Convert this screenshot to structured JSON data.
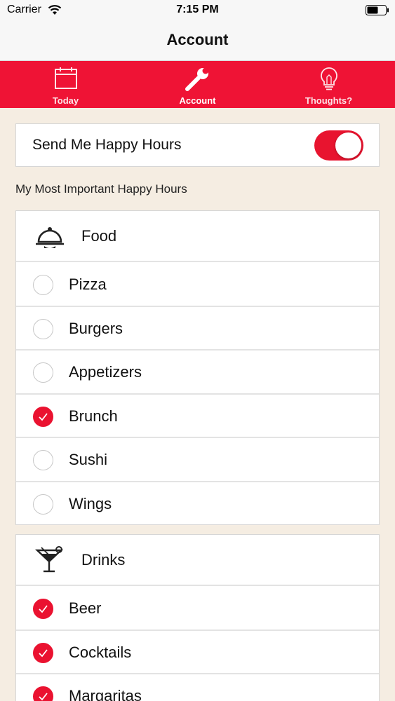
{
  "status_bar": {
    "carrier": "Carrier",
    "time": "7:15 PM"
  },
  "nav": {
    "title": "Account"
  },
  "tabs": [
    {
      "label": "Today",
      "icon": "calendar-icon"
    },
    {
      "label": "Account",
      "icon": "wrench-icon"
    },
    {
      "label": "Thoughts?",
      "icon": "lightbulb-icon"
    }
  ],
  "notifications": {
    "label": "Send Me Happy Hours",
    "enabled": true
  },
  "section_heading": "My Most Important Happy Hours",
  "categories": [
    {
      "name": "Food",
      "icon": "cloche-icon",
      "items": [
        {
          "label": "Pizza",
          "checked": false
        },
        {
          "label": "Burgers",
          "checked": false
        },
        {
          "label": "Appetizers",
          "checked": false
        },
        {
          "label": "Brunch",
          "checked": true
        },
        {
          "label": "Sushi",
          "checked": false
        },
        {
          "label": "Wings",
          "checked": false
        }
      ]
    },
    {
      "name": "Drinks",
      "icon": "cocktail-glass-icon",
      "items": [
        {
          "label": "Beer",
          "checked": true
        },
        {
          "label": "Cocktails",
          "checked": true
        },
        {
          "label": "Margaritas",
          "checked": true
        }
      ]
    }
  ],
  "colors": {
    "accent": "#ef1335",
    "background": "#f5ede2"
  }
}
